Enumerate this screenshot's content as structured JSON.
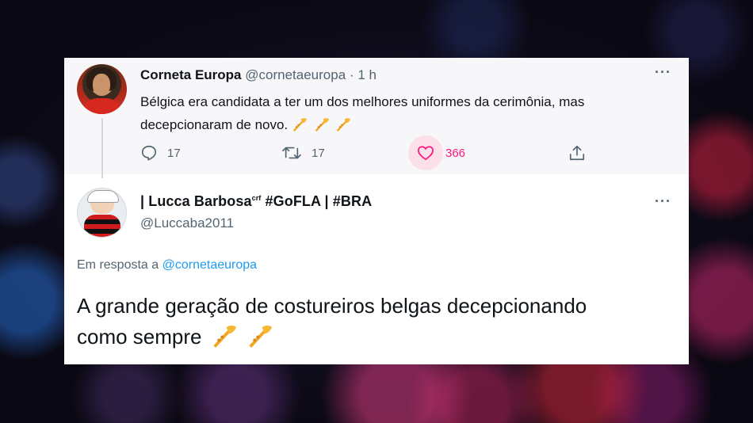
{
  "tweet1": {
    "display_name": "Corneta Europa",
    "handle": "@cornetaeuropa",
    "separator": "·",
    "time": "1 h",
    "text_line1": "Bélgica era candidata a ter um dos melhores uniformes da cerimônia, mas",
    "text_line2": "decepcionaram de novo.",
    "emoji": [
      "trumpet-icon",
      "trumpet-icon",
      "trumpet-icon"
    ],
    "reply_count": "17",
    "retweet_count": "17",
    "like_count": "366",
    "liked": true
  },
  "tweet2": {
    "display_name": "| Lucca Barbosa",
    "name_superscript": "crf",
    "name_suffix": " #GoFLA | #BRA",
    "handle": "@Luccaba2011",
    "reply_prefix": "Em resposta a ",
    "reply_handle": "@cornetaeuropa",
    "text_line1": "A grande geração de costureiros belgas decepcionando",
    "text_line2": "como sempre",
    "emoji": [
      "trumpet-icon",
      "trumpet-icon"
    ]
  },
  "colors": {
    "like_pink": "#f91880",
    "link_blue": "#1d9bf0",
    "secondary_text": "#536471",
    "primary_text": "#0f1419"
  }
}
